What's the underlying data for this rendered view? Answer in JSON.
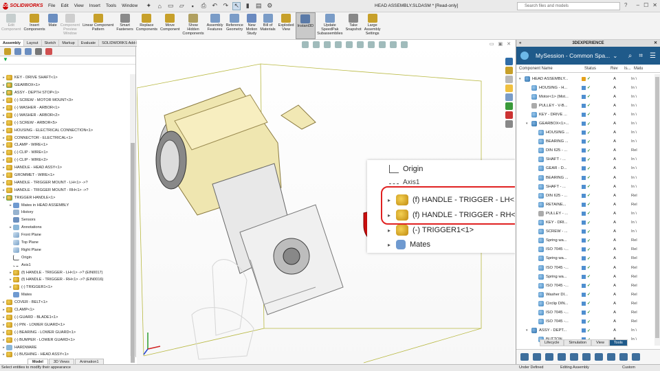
{
  "app": {
    "brand": "SOLIDWORKS",
    "doc_title": "HEAD ASSEMBLY.SLDASM * [Read-only]"
  },
  "menu": [
    "File",
    "Edit",
    "View",
    "Insert",
    "Tools",
    "Window"
  ],
  "search": {
    "placeholder": "Search files and models"
  },
  "commands": [
    {
      "label": "Edit\nComponent",
      "disabled": true,
      "color": "#9aa"
    },
    {
      "label": "Insert\nComponents",
      "color": "#c7a02a"
    },
    {
      "label": "Mate",
      "color": "#6b8ec0"
    },
    {
      "label": "Component\nPreview\nWindow",
      "disabled": true,
      "color": "#aaa"
    },
    {
      "label": "Linear Component\nPattern",
      "color": "#c7a02a"
    },
    {
      "label": "Smart\nFasteners",
      "color": "#8a8a8a"
    },
    {
      "label": "Replace\nComponents",
      "color": "#c7a02a"
    },
    {
      "label": "Move\nComponent",
      "color": "#c7a02a"
    },
    {
      "label": "Show\nHidden\nComponents",
      "color": "#b0a060"
    },
    {
      "label": "Assembly\nFeatures",
      "color": "#7a9cc7"
    },
    {
      "label": "Reference\nGeometry",
      "color": "#7a9cc7"
    },
    {
      "label": "New\nMotion\nStudy",
      "color": "#6a8ac0"
    },
    {
      "label": "Bill of\nMaterials",
      "color": "#7a9cc7"
    },
    {
      "label": "Exploded\nView",
      "color": "#c7a02a"
    },
    {
      "label": "Instant3D",
      "active": true,
      "color": "#5a7aa8"
    },
    {
      "label": "Update\nSpeedPak\nSubassemblies",
      "color": "#7a9cc7"
    },
    {
      "label": "Take\nSnapshot",
      "color": "#888"
    },
    {
      "label": "Large\nAssembly\nSettings",
      "color": "#c7a02a"
    }
  ],
  "tabs": [
    "Assembly",
    "Layout",
    "Sketch",
    "Markup",
    "Evaluate",
    "SOLIDWORKS Add-Ins",
    "MBD"
  ],
  "tree": [
    {
      "label": "KEY - DRIVE SHAFT<1>",
      "icon": "part",
      "exp": "▸"
    },
    {
      "label": "GEARBOX<1>",
      "icon": "asm",
      "exp": "▸"
    },
    {
      "label": "ASSY - DEPTH STOP<1>",
      "icon": "asm",
      "exp": "▸"
    },
    {
      "label": "(-) SCREW - MOTOR MOUNT<3>",
      "icon": "part",
      "exp": "▸"
    },
    {
      "label": "(-) WASHER - ARBOR<1>",
      "icon": "part",
      "exp": "▸"
    },
    {
      "label": "(-) WASHER - ARBOR<2>",
      "icon": "part",
      "exp": "▸"
    },
    {
      "label": "(-) SCREW - ARBOR<5>",
      "icon": "part",
      "exp": "▸"
    },
    {
      "label": "HOUSING - ELECTRICAL CONNECTION<1>",
      "icon": "part",
      "exp": "▸"
    },
    {
      "label": "CONNECTOR - ELECTRICAL<1>",
      "icon": "part",
      "exp": "▸"
    },
    {
      "label": "CLAMP - WIRE<1>",
      "icon": "part",
      "exp": "▸"
    },
    {
      "label": "(-) CLIP - WIRE<1>",
      "icon": "part",
      "exp": "▸"
    },
    {
      "label": "(-) CLIP - WIRE<2>",
      "icon": "part",
      "exp": "▸"
    },
    {
      "label": "HANDLE - HEAD ASSY<1>",
      "icon": "part",
      "exp": "▸"
    },
    {
      "label": "GROMMET - WIRE<1>",
      "icon": "part",
      "exp": "▸"
    },
    {
      "label": "HANDLE - TRIGGER MOUNT - LH<1> ->?",
      "icon": "part",
      "exp": "▸"
    },
    {
      "label": "HANDLE - TRIGGER MOUNT - RH<1> ->?",
      "icon": "part",
      "exp": "▸"
    },
    {
      "label": "TRIGGER HANDLE<1>",
      "icon": "asm",
      "exp": "▾"
    },
    {
      "label": "Mates in HEAD ASSEMBLY",
      "icon": "mates",
      "exp": "▸",
      "indent": 1
    },
    {
      "label": "History",
      "icon": "hist",
      "exp": "",
      "indent": 1
    },
    {
      "label": "Sensors",
      "icon": "sensor",
      "exp": "",
      "indent": 1
    },
    {
      "label": "Annotations",
      "icon": "folder",
      "exp": "▸",
      "indent": 1
    },
    {
      "label": "Front Plane",
      "icon": "plane",
      "exp": "",
      "indent": 1
    },
    {
      "label": "Top Plane",
      "icon": "plane",
      "exp": "",
      "indent": 1
    },
    {
      "label": "Right Plane",
      "icon": "plane",
      "exp": "",
      "indent": 1
    },
    {
      "label": "Origin",
      "icon": "origin",
      "exp": "",
      "indent": 1
    },
    {
      "label": "Axis1",
      "icon": "axis",
      "exp": "",
      "indent": 1
    },
    {
      "label": "(f) HANDLE - TRIGGER - LH<1> ->? (EIN0017)",
      "icon": "part",
      "exp": "▸",
      "indent": 1
    },
    {
      "label": "(f) HANDLE - TRIGGER - RH<1> ->? (EIN0016)",
      "icon": "part",
      "exp": "▸",
      "indent": 1
    },
    {
      "label": "(-) TRIGGER1<1>",
      "icon": "part",
      "exp": "▸",
      "indent": 1
    },
    {
      "label": "Mates",
      "icon": "mates",
      "exp": "",
      "indent": 1
    },
    {
      "label": "COVER - BELT<1>",
      "icon": "part",
      "exp": "▸"
    },
    {
      "label": "CLAMP<1>",
      "icon": "part",
      "exp": "▸"
    },
    {
      "label": "(-) GUARD - BLADE1<1>",
      "icon": "part",
      "exp": "▸"
    },
    {
      "label": "(-) PIN - LOWER GUARD<1>",
      "icon": "part",
      "exp": "▸"
    },
    {
      "label": "(-) BEARING - LOWER GUARD<1>",
      "icon": "part",
      "exp": "▸"
    },
    {
      "label": "(-) BUMPER - LOWER GUARD<1>",
      "icon": "part",
      "exp": "▸"
    },
    {
      "label": "HARDWARE",
      "icon": "folder",
      "exp": "▸"
    },
    {
      "label": "(-) BUSHING - HEAD ASSY<1>",
      "icon": "part",
      "exp": "▸"
    }
  ],
  "bottom_tabs": [
    "Model",
    "3D Views",
    "Animation1"
  ],
  "callout": {
    "origin": "Origin",
    "axis": "Axis1",
    "lh": "(f) HANDLE - TRIGGER - LH<1> ->? (EIN0017)",
    "rh": "(f) HANDLE - TRIGGER - RH<1> ->? (EIN0016)",
    "trigger": "(-) TRIGGER1<1>",
    "mates": "Mates"
  },
  "taskpane": {
    "header": "3DEXPERIENCE",
    "session": "MySession - Common Spa...",
    "columns": [
      "Component Name",
      "Status",
      "Rev",
      "Is...",
      "Matu"
    ],
    "tabs": [
      "Lifecycle",
      "Simulation",
      "View",
      "Tools"
    ],
    "active_tab": "Tools",
    "rows": [
      {
        "name": "HEAD ASSEMBLY...",
        "icon": "a",
        "exp": "▾",
        "indent": 0,
        "status": "lock",
        "rev": "A",
        "mat": "In \\"
      },
      {
        "name": "HOUSING - H...",
        "icon": "p",
        "exp": "",
        "indent": 1,
        "rev": "A",
        "mat": "In \\"
      },
      {
        "name": "Motor<1> (Mot...",
        "icon": "p",
        "exp": "",
        "indent": 1,
        "rev": "A",
        "mat": "In \\"
      },
      {
        "name": "PULLEY - V-B...",
        "icon": "g",
        "exp": "",
        "indent": 1,
        "rev": "A",
        "mat": "In \\"
      },
      {
        "name": "KEY - DRIVE ...",
        "icon": "p",
        "exp": "",
        "indent": 1,
        "rev": "A",
        "mat": "In \\"
      },
      {
        "name": "GEARBOX<1>...",
        "icon": "a",
        "exp": "▾",
        "indent": 1,
        "rev": "A",
        "mat": "In \\"
      },
      {
        "name": "HOUSING ...",
        "icon": "p",
        "exp": "",
        "indent": 2,
        "rev": "A",
        "mat": "In \\"
      },
      {
        "name": "BEARING ...",
        "icon": "p",
        "exp": "",
        "indent": 2,
        "rev": "A",
        "mat": "In \\"
      },
      {
        "name": "DIN 625 - ...",
        "icon": "p",
        "exp": "",
        "indent": 2,
        "rev": "A",
        "mat": "Rel"
      },
      {
        "name": "SHAFT - ...",
        "icon": "p",
        "exp": "",
        "indent": 2,
        "rev": "A",
        "mat": "In \\"
      },
      {
        "name": "GEAR - D...",
        "icon": "p",
        "exp": "",
        "indent": 2,
        "rev": "A",
        "mat": "In \\"
      },
      {
        "name": "BEARING ...",
        "icon": "p",
        "exp": "",
        "indent": 2,
        "rev": "A",
        "mat": "In \\"
      },
      {
        "name": "SHAFT - ...",
        "icon": "p",
        "exp": "",
        "indent": 2,
        "rev": "A",
        "mat": "In \\"
      },
      {
        "name": "DIN 625 - ...",
        "icon": "p",
        "exp": "",
        "indent": 2,
        "rev": "A",
        "mat": "Rel"
      },
      {
        "name": "RETAINE...",
        "icon": "p",
        "exp": "",
        "indent": 2,
        "rev": "A",
        "mat": "Rel"
      },
      {
        "name": "PULLEY - ...",
        "icon": "g",
        "exp": "",
        "indent": 2,
        "rev": "A",
        "mat": "In \\"
      },
      {
        "name": "KEY - DRI...",
        "icon": "p",
        "exp": "",
        "indent": 2,
        "rev": "A",
        "mat": "In \\"
      },
      {
        "name": "SCREW - ...",
        "icon": "p",
        "exp": "",
        "indent": 2,
        "rev": "A",
        "mat": "In \\"
      },
      {
        "name": "Spring wa...",
        "icon": "p",
        "exp": "",
        "indent": 2,
        "rev": "A",
        "mat": "Rel"
      },
      {
        "name": "ISO 7045 -...",
        "icon": "p",
        "exp": "",
        "indent": 2,
        "rev": "A",
        "mat": "Rel"
      },
      {
        "name": "Spring wa...",
        "icon": "p",
        "exp": "",
        "indent": 2,
        "rev": "A",
        "mat": "Rel"
      },
      {
        "name": "ISO 7045 -...",
        "icon": "p",
        "exp": "",
        "indent": 2,
        "rev": "A",
        "mat": "Rel"
      },
      {
        "name": "Spring wa...",
        "icon": "p",
        "exp": "",
        "indent": 2,
        "rev": "A",
        "mat": "Rel"
      },
      {
        "name": "ISO 7045 -...",
        "icon": "p",
        "exp": "",
        "indent": 2,
        "rev": "A",
        "mat": "Rel"
      },
      {
        "name": "Washer DI...",
        "icon": "p",
        "exp": "",
        "indent": 2,
        "rev": "A",
        "mat": "Rel"
      },
      {
        "name": "Circlip DIN...",
        "icon": "p",
        "exp": "",
        "indent": 2,
        "rev": "A",
        "mat": "Rel"
      },
      {
        "name": "ISO 7045 -...",
        "icon": "p",
        "exp": "",
        "indent": 2,
        "rev": "A",
        "mat": "Rel"
      },
      {
        "name": "ISO 7045 -...",
        "icon": "p",
        "exp": "",
        "indent": 2,
        "rev": "A",
        "mat": "Rel"
      },
      {
        "name": "ASSY - DEPT...",
        "icon": "a",
        "exp": "▾",
        "indent": 1,
        "rev": "A",
        "mat": "In \\"
      },
      {
        "name": "BUTTON ...",
        "icon": "p",
        "exp": "",
        "indent": 2,
        "rev": "A",
        "mat": "In \\"
      }
    ]
  },
  "status": {
    "hint": "Select entities to modify their appearance",
    "defined": "Under Defined",
    "mode": "Editing Assembly",
    "units": "Custom"
  },
  "colors": {
    "accent": "#1f5a8a",
    "highlight": "#e02020",
    "part_yellow": "#e2b93a"
  }
}
